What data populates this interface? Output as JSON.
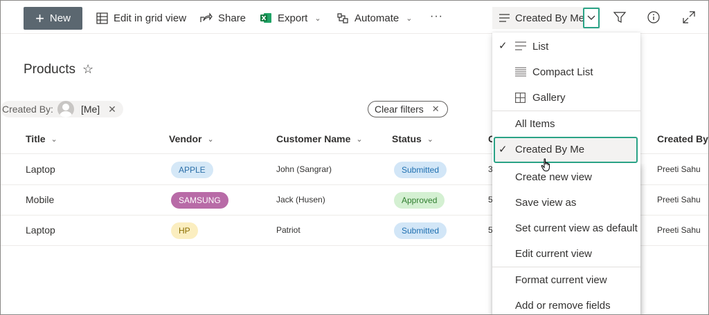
{
  "toolbar": {
    "new_label": "New",
    "edit_grid_label": "Edit in grid view",
    "share_label": "Share",
    "export_label": "Export",
    "automate_label": "Automate",
    "more_label": "···",
    "view_selector_label": "Created By Me"
  },
  "page": {
    "title": "Products"
  },
  "filters": {
    "created_by_label": "Created By:",
    "created_by_value": "[Me]",
    "clear_label": "Clear filters"
  },
  "table": {
    "columns": [
      "Title",
      "Vendor",
      "Customer Name",
      "Status",
      "C",
      "Created By"
    ],
    "rows": [
      {
        "title": "Laptop",
        "vendor": "APPLE",
        "customer": "John (Sangrar)",
        "status": "Submitted",
        "c": "3",
        "created_by": "Preeti Sahu"
      },
      {
        "title": "Mobile",
        "vendor": "SAMSUNG",
        "customer": "Jack (Husen)",
        "status": "Approved",
        "c": "5",
        "created_by": "Preeti Sahu"
      },
      {
        "title": "Laptop",
        "vendor": "HP",
        "customer": "Patriot",
        "status": "Submitted",
        "c": "5",
        "created_by": "Preeti Sahu"
      }
    ]
  },
  "view_menu": {
    "layouts": [
      {
        "label": "List",
        "icon": "list-icon",
        "checked": true
      },
      {
        "label": "Compact List",
        "icon": "compact-list-icon",
        "checked": false
      },
      {
        "label": "Gallery",
        "icon": "gallery-icon",
        "checked": false
      }
    ],
    "views": [
      {
        "label": "All Items",
        "checked": false
      },
      {
        "label": "Created By Me",
        "checked": true
      }
    ],
    "actions": [
      "Create new view",
      "Save view as",
      "Set current view as default",
      "Edit current view"
    ],
    "more_actions": [
      "Format current view",
      "Add or remove fields"
    ]
  },
  "colors": {
    "new_button": "#5b6770",
    "highlight": "#2aa386",
    "tag_apple_bg": "#d5e8f7",
    "tag_apple_fg": "#2b6ea8",
    "tag_samsung_bg": "#b86ba7",
    "tag_samsung_fg": "#ffffff",
    "tag_hp_bg": "#fbeec0",
    "tag_hp_fg": "#8a6d00",
    "status_submitted_bg": "#d2e6f7",
    "status_submitted_fg": "#1e6fb0",
    "status_approved_bg": "#d4f0d2",
    "status_approved_fg": "#2f7d2e"
  }
}
